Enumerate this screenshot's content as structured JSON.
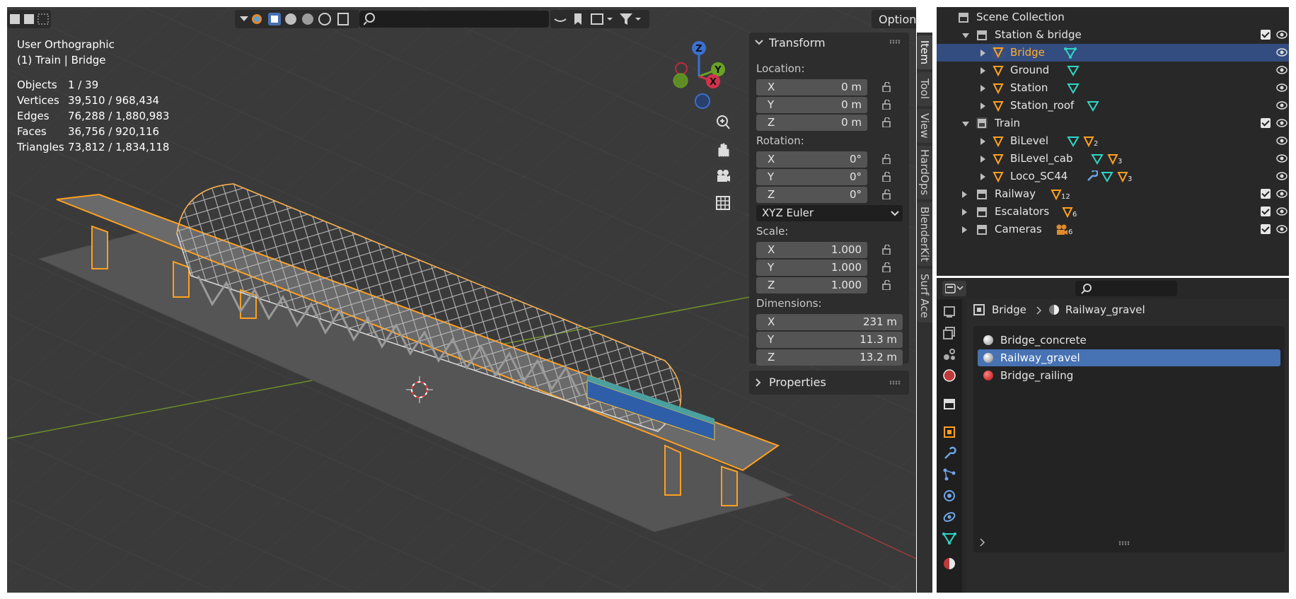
{
  "viewport": {
    "view_name": "User Orthographic",
    "context": "(1) Train | Bridge",
    "stats": [
      {
        "label": "Objects",
        "value": "1 / 39"
      },
      {
        "label": "Vertices",
        "value": "39,510 / 968,434"
      },
      {
        "label": "Edges",
        "value": "76,288 / 1,880,983"
      },
      {
        "label": "Faces",
        "value": "36,756 / 920,116"
      },
      {
        "label": "Triangles",
        "value": "73,812 / 1,834,118"
      }
    ],
    "options_label": "Options",
    "gizmo": {
      "x": "X",
      "y": "Y",
      "z": "Z"
    }
  },
  "npanel": {
    "tabs": [
      "Item",
      "Tool",
      "View",
      "HardOps",
      "BlenderKit",
      "Surf Ace"
    ],
    "transform_title": "Transform",
    "location_label": "Location:",
    "location": [
      {
        "axis": "X",
        "value": "0 m"
      },
      {
        "axis": "Y",
        "value": "0 m"
      },
      {
        "axis": "Z",
        "value": "0 m"
      }
    ],
    "rotation_label": "Rotation:",
    "rotation": [
      {
        "axis": "X",
        "value": "0°"
      },
      {
        "axis": "Y",
        "value": "0°"
      },
      {
        "axis": "Z",
        "value": "0°"
      }
    ],
    "rotation_mode": "XYZ Euler",
    "scale_label": "Scale:",
    "scale": [
      {
        "axis": "X",
        "value": "1.000"
      },
      {
        "axis": "Y",
        "value": "1.000"
      },
      {
        "axis": "Z",
        "value": "1.000"
      }
    ],
    "dimensions_label": "Dimensions:",
    "dimensions": [
      {
        "axis": "X",
        "value": "231 m"
      },
      {
        "axis": "Y",
        "value": "11.3 m"
      },
      {
        "axis": "Z",
        "value": "13.2 m"
      }
    ],
    "properties_title": "Properties"
  },
  "outliner": {
    "root": "Scene Collection",
    "rows": [
      {
        "label": "Station & bridge",
        "type": "collection"
      },
      {
        "label": "Bridge",
        "type": "object",
        "selected": true
      },
      {
        "label": "Ground",
        "type": "object"
      },
      {
        "label": "Station",
        "type": "object"
      },
      {
        "label": "Station_roof",
        "type": "object"
      },
      {
        "label": "Train",
        "type": "collection"
      },
      {
        "label": "BiLevel",
        "type": "object",
        "badge": "2"
      },
      {
        "label": "BiLevel_cab",
        "type": "object",
        "badge": "3"
      },
      {
        "label": "Loco_SC44",
        "type": "object",
        "badge": "3"
      },
      {
        "label": "Railway",
        "type": "collection",
        "badge": "12"
      },
      {
        "label": "Escalators",
        "type": "collection",
        "badge": "6"
      },
      {
        "label": "Cameras",
        "type": "collection",
        "badge": "6"
      }
    ]
  },
  "properties": {
    "breadcrumb_object": "Bridge",
    "breadcrumb_material": "Railway_gravel",
    "materials": [
      {
        "label": "Bridge_concrete",
        "color": "#e0e0e0"
      },
      {
        "label": "Railway_gravel",
        "color": "#d9d9d9",
        "selected": true
      },
      {
        "label": "Bridge_railing",
        "color": "#e02020"
      }
    ]
  },
  "colors": {
    "selection_orange": "#ffa020",
    "active_row": "#334d80",
    "selected_material": "#4772b3"
  }
}
